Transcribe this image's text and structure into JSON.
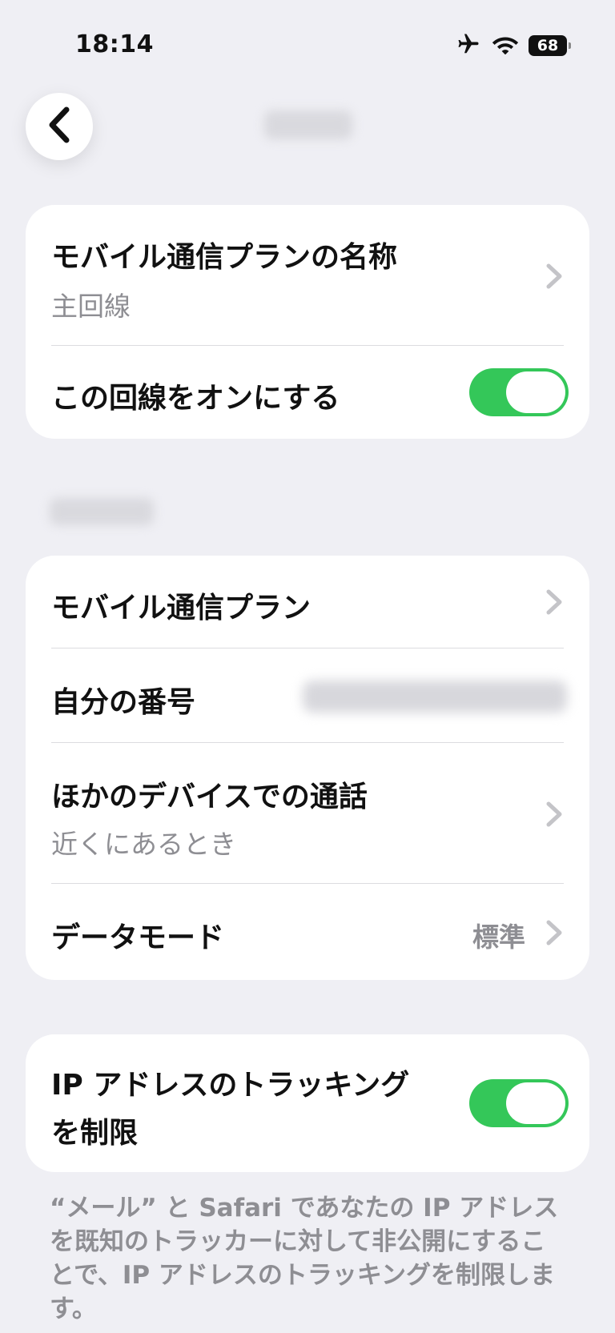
{
  "status_bar": {
    "time": "18:14",
    "battery": "68",
    "icons": [
      "airplane-icon",
      "wifi-icon",
      "battery-icon"
    ]
  },
  "nav": {
    "back_icon": "chevron-left-icon"
  },
  "group1": {
    "plan_name_label": "モバイル通信プランの名称",
    "plan_name_value": "主回線",
    "line_on_label": "この回線をオンにする",
    "line_on_toggle": true
  },
  "group2": {
    "mobile_plan_label": "モバイル通信プラン",
    "my_number_label": "自分の番号",
    "other_devices_label": "ほかのデバイスでの通話",
    "other_devices_value": "近くにあるとき",
    "data_mode_label": "データモード",
    "data_mode_value": "標準"
  },
  "group3": {
    "ip_tracking_label_line1": "IP アドレスのトラッキング",
    "ip_tracking_label_line2": "を制限",
    "ip_tracking_toggle": true
  },
  "footer": {
    "note": "“メール” と Safari であなたの IP アドレスを既知のトラッカーに対して非公開にすることで、IP アドレスのトラッキングを制限します。"
  },
  "colors": {
    "background": "#efeff4",
    "toggle_on": "#34c759",
    "secondary_text": "#8e8e93"
  }
}
